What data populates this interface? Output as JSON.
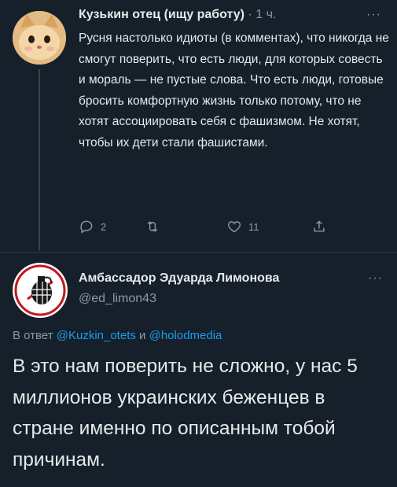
{
  "tweet1": {
    "author_name": "Кузькин отец (ищу работу)",
    "separator": "·",
    "time": "1 ч.",
    "more": "···",
    "text": "Русня настолько идиоты (в комментах), что никогда не смогут поверить, что есть люди, для которых совесть и мораль — не пустые слова. Что есть люди, готовые бросить комфортную жизнь только потому, что не хотят ассоциировать себя с фашизмом. Не хотят, чтобы их дети стали фашистами.",
    "replies": "2",
    "likes": "11",
    "icons": [
      "reply-icon",
      "retweet-icon",
      "like-icon",
      "share-icon"
    ]
  },
  "tweet2": {
    "author_name": "Амбассадор Эдуарда Лимонова",
    "handle": "@ed_limon43",
    "more": "···",
    "reply_prefix": "В ответ",
    "reply_mention_1": "@Kuzkin_otets",
    "reply_and": "и",
    "reply_mention_2": "@holodmedia",
    "text": "В это нам поверить не сложно, у нас  5 миллионов украинских беженцев в стране именно по описанным тобой причинам."
  },
  "colors": {
    "background": "#15202b",
    "text": "#e7e9ea",
    "secondary": "#8b98a5",
    "link": "#1d9bf0"
  }
}
